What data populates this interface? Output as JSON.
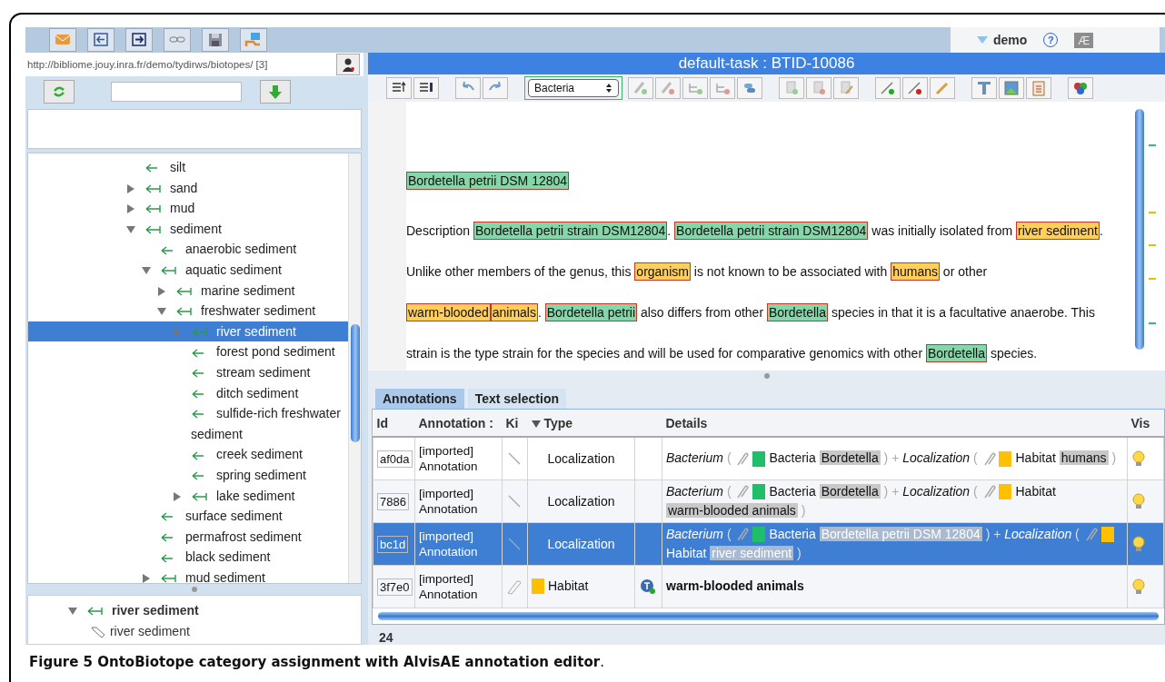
{
  "top_bar": {
    "user": "demo",
    "help": "?",
    "logo": "Æ"
  },
  "left_panel": {
    "url": "http://bibliome.jouy.inra.fr/demo/tydirws/biotopes/ [3]",
    "tree": [
      {
        "label": "silt",
        "kind": "leaf",
        "selected": false
      },
      {
        "label": "sand",
        "kind": "branch",
        "expanded": false,
        "selected": false
      },
      {
        "label": "mud",
        "kind": "branch",
        "expanded": false,
        "selected": false
      },
      {
        "label": "sediment",
        "kind": "branch",
        "expanded": true,
        "selected": false,
        "children": [
          {
            "label": "anaerobic sediment",
            "kind": "leaf",
            "selected": false
          },
          {
            "label": "aquatic sediment",
            "kind": "branch",
            "expanded": true,
            "selected": false,
            "children": [
              {
                "label": "marine sediment",
                "kind": "branch",
                "expanded": false,
                "selected": false
              },
              {
                "label": "freshwater sediment",
                "kind": "branch",
                "expanded": true,
                "selected": false,
                "children": [
                  {
                    "label": "river sediment",
                    "kind": "branch",
                    "expanded": false,
                    "selected": true
                  },
                  {
                    "label": "forest pond sediment",
                    "kind": "leaf",
                    "selected": false
                  },
                  {
                    "label": "stream sediment",
                    "kind": "leaf",
                    "selected": false
                  },
                  {
                    "label": "ditch sediment",
                    "kind": "leaf",
                    "selected": false
                  },
                  {
                    "label": "sulfide-rich freshwater sediment",
                    "kind": "leaf",
                    "selected": false
                  },
                  {
                    "label": "creek sediment",
                    "kind": "leaf",
                    "selected": false
                  },
                  {
                    "label": "spring sediment",
                    "kind": "leaf",
                    "selected": false
                  },
                  {
                    "label": "lake sediment",
                    "kind": "branch",
                    "expanded": false,
                    "selected": false
                  }
                ]
              }
            ]
          },
          {
            "label": "surface sediment",
            "kind": "leaf",
            "selected": false
          },
          {
            "label": "permafrost sediment",
            "kind": "leaf",
            "selected": false
          },
          {
            "label": "black sediment",
            "kind": "leaf",
            "selected": false
          },
          {
            "label": "mud sediment",
            "kind": "branch",
            "expanded": false,
            "selected": false
          }
        ]
      }
    ],
    "selection_tree": [
      {
        "label": "river sediment",
        "kind": "concept",
        "expanded": true,
        "children": [
          {
            "label": "river sediment",
            "kind": "term"
          }
        ]
      }
    ]
  },
  "editor": {
    "title": "default-task : BTID-10086",
    "type_select": "Bacteria",
    "heading": {
      "text": "Bordetella petrii DSM 12804",
      "kind": "bacterium"
    },
    "paragraph": [
      {
        "kind": "plain",
        "text": "Description "
      },
      {
        "kind": "bacterium",
        "text": "Bordetella petrii strain DSM12804"
      },
      {
        "kind": "plain",
        "text": ". "
      },
      {
        "kind": "bacterium",
        "text": "Bordetella petrii strain DSM12804"
      },
      {
        "kind": "plain",
        "text": " was initially isolated from "
      },
      {
        "kind": "habitat",
        "text": "river sediment"
      },
      {
        "kind": "plain",
        "text": ". Unlike other members of the genus, this "
      },
      {
        "kind": "habitat",
        "text": "organism"
      },
      {
        "kind": "plain",
        "text": " is not known to be associated with "
      },
      {
        "kind": "habitat",
        "text": "humans"
      },
      {
        "kind": "plain",
        "text": " or other "
      },
      {
        "kind": "habitat",
        "text": "warm-blooded"
      },
      {
        "kind": "habitat",
        "text": "animals"
      },
      {
        "kind": "plain",
        "text": ". "
      },
      {
        "kind": "bacterium",
        "text": "Bordetella petrii"
      },
      {
        "kind": "plain",
        "text": " also differs from other "
      },
      {
        "kind": "bacterium",
        "text": "Bordetella"
      },
      {
        "kind": "plain",
        "text": " species in that it is a facultative anaerobe. This strain is the type strain for the species and will be used for comparative genomics with other "
      },
      {
        "kind": "bacterium",
        "text": "Bordetella"
      },
      {
        "kind": "plain",
        "text": " species."
      }
    ]
  },
  "tabs": [
    {
      "label": "Annotations",
      "selected": true
    },
    {
      "label": "Text selection",
      "selected": false
    }
  ],
  "table": {
    "columns": [
      {
        "label": "Id"
      },
      {
        "label": "Annotation :"
      },
      {
        "label": "Ki"
      },
      {
        "label": "Type",
        "sorted": true
      },
      {
        "label": "Details"
      },
      {
        "label": "Vis"
      }
    ],
    "rows": [
      {
        "id": "af0da",
        "annotation": "[imported] Annotation",
        "kind": "relation",
        "type": {
          "text": "Localization"
        },
        "selected": false,
        "details": [
          {
            "kind": "role",
            "text": "Bacterium"
          },
          {
            "kind": "punct",
            "text": "("
          },
          {
            "kind": "clip"
          },
          {
            "kind": "swatch",
            "color": "#1fbf6a"
          },
          {
            "kind": "plain",
            "text": "Bacteria"
          },
          {
            "kind": "mention",
            "text": "Bordetella"
          },
          {
            "kind": "punct",
            "text": ")"
          },
          {
            "kind": "punct",
            "text": "+"
          },
          {
            "kind": "role",
            "text": "Localization"
          },
          {
            "kind": "punct",
            "text": "("
          },
          {
            "kind": "clip"
          },
          {
            "kind": "swatch",
            "color": "#ffc000"
          },
          {
            "kind": "plain",
            "text": "Habitat"
          },
          {
            "kind": "mention",
            "text": "humans"
          },
          {
            "kind": "punct",
            "text": ")"
          }
        ]
      },
      {
        "id": "7886",
        "annotation": "[imported] Annotation",
        "kind": "relation",
        "type": {
          "text": "Localization"
        },
        "selected": false,
        "details": [
          {
            "kind": "role",
            "text": "Bacterium"
          },
          {
            "kind": "punct",
            "text": "("
          },
          {
            "kind": "clip"
          },
          {
            "kind": "swatch",
            "color": "#1fbf6a"
          },
          {
            "kind": "plain",
            "text": "Bacteria"
          },
          {
            "kind": "mention",
            "text": "Bordetella"
          },
          {
            "kind": "punct",
            "text": ")"
          },
          {
            "kind": "punct",
            "text": "+"
          },
          {
            "kind": "role",
            "text": "Localization"
          },
          {
            "kind": "punct",
            "text": "("
          },
          {
            "kind": "clip"
          },
          {
            "kind": "swatch",
            "color": "#ffc000"
          },
          {
            "kind": "plain",
            "text": "Habitat"
          },
          {
            "kind": "mention",
            "text": "warm-blooded animals"
          },
          {
            "kind": "punct",
            "text": ")"
          }
        ]
      },
      {
        "id": "bc1d",
        "annotation": "[imported] Annotation",
        "kind": "relation",
        "type": {
          "text": "Localization"
        },
        "selected": true,
        "details": [
          {
            "kind": "role",
            "text": "Bacterium"
          },
          {
            "kind": "punct",
            "text": "("
          },
          {
            "kind": "clip"
          },
          {
            "kind": "swatch",
            "color": "#1fbf6a"
          },
          {
            "kind": "plain",
            "text": "Bacteria"
          },
          {
            "kind": "mention",
            "text": "Bordetella petrii DSM 12804"
          },
          {
            "kind": "punct",
            "text": ")"
          },
          {
            "kind": "punct",
            "text": "+"
          },
          {
            "kind": "role",
            "text": "Localization"
          },
          {
            "kind": "punct",
            "text": "("
          },
          {
            "kind": "clip"
          },
          {
            "kind": "swatch",
            "color": "#ffc000"
          },
          {
            "kind": "plain",
            "text": "Habitat"
          },
          {
            "kind": "mention",
            "text": "river sediment"
          },
          {
            "kind": "punct",
            "text": ")"
          }
        ]
      },
      {
        "id": "3f7e0",
        "annotation": "[imported] Annotation",
        "kind": "entity",
        "type": {
          "text": "Habitat",
          "color": "#ffc000"
        },
        "selected": false,
        "details": [
          {
            "kind": "strong",
            "text": "warm-blooded animals"
          }
        ]
      }
    ]
  },
  "footer": {
    "count": "24"
  },
  "caption": "**Figure 5 OntoBiotope category assignment with AlvisAE annotation editor**."
}
